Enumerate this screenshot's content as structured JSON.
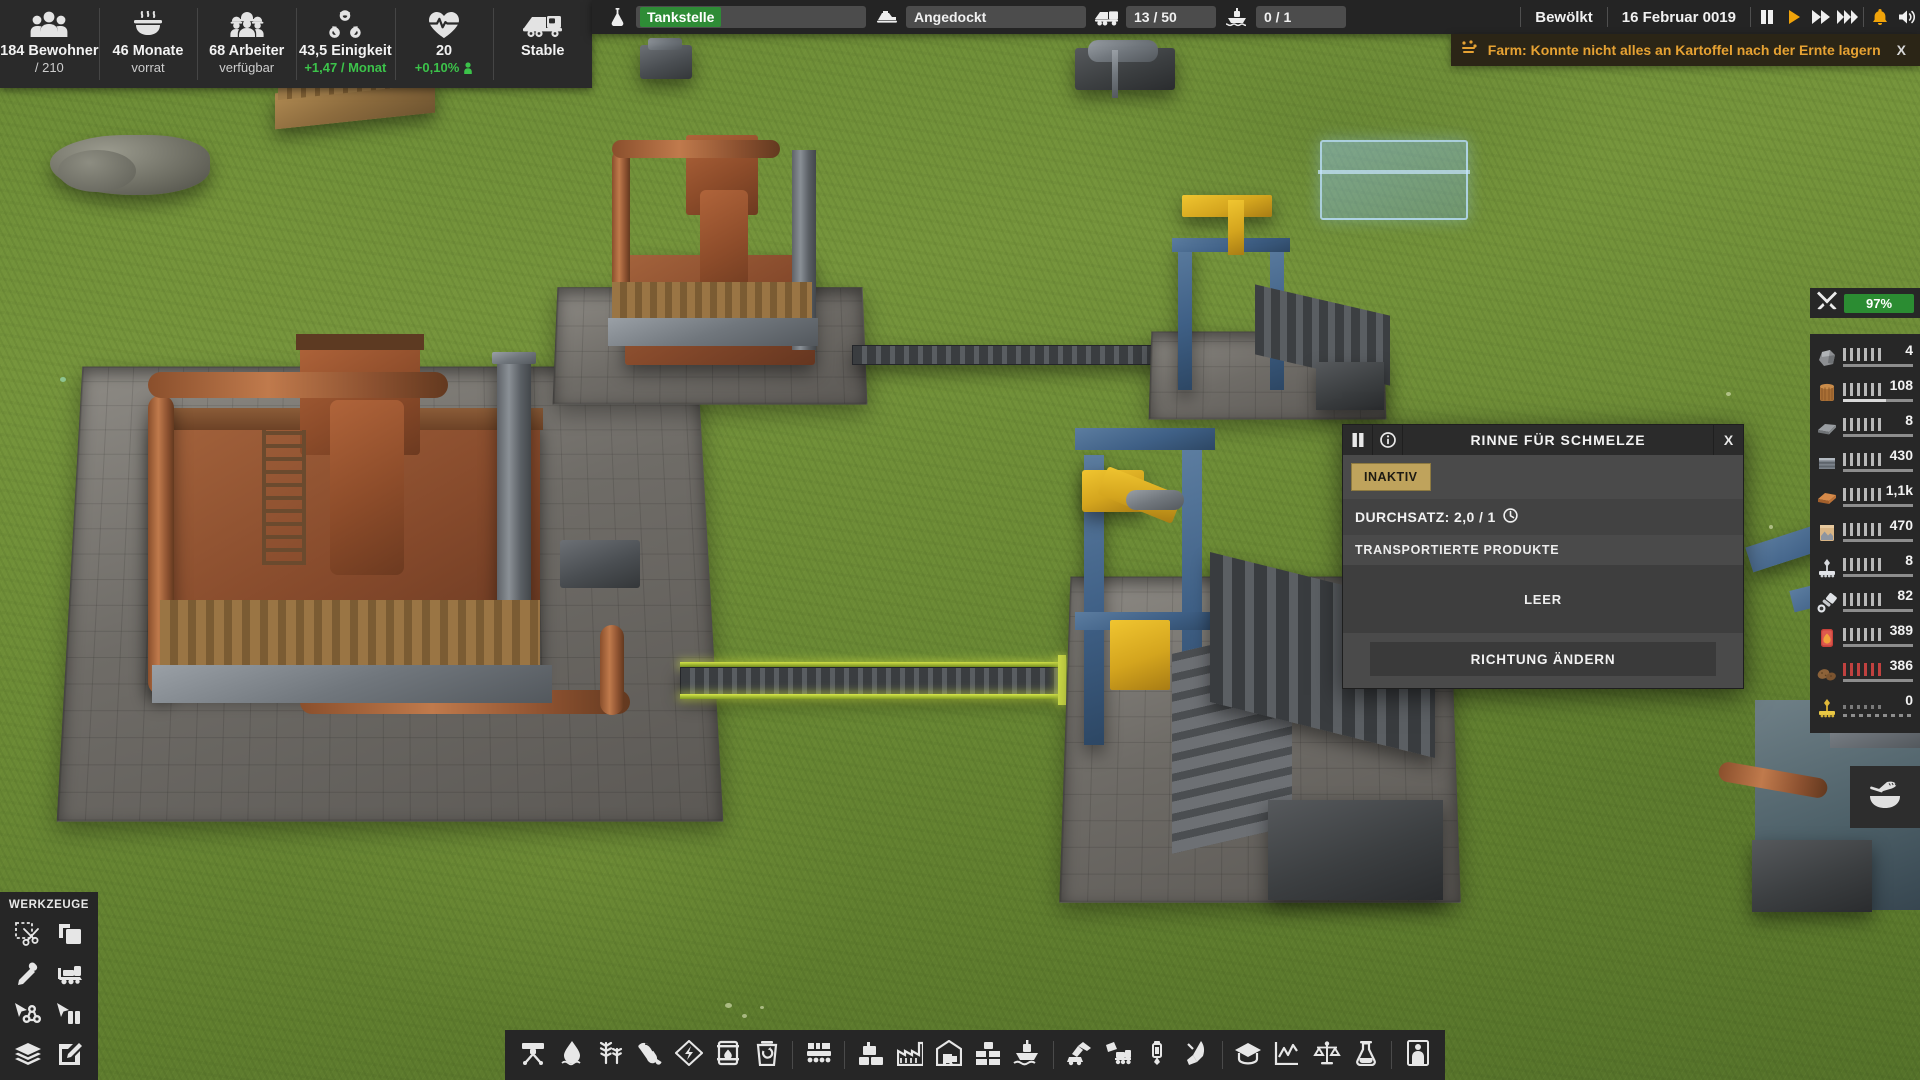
{
  "hud_left": {
    "stats": [
      {
        "icon": "population-icon",
        "main": "184 Bewohner",
        "sub": "/ 210",
        "sub_style": "normal"
      },
      {
        "icon": "food-bowl-icon",
        "main": "46 Monate",
        "sub": "vorrat",
        "sub_style": "normal"
      },
      {
        "icon": "workers-icon",
        "main": "68 Arbeiter",
        "sub": "verfügbar",
        "sub_style": "normal"
      },
      {
        "icon": "unity-icon",
        "main": "43,5 Einigkeit",
        "sub": "+1,47 / Monat",
        "sub_style": "green"
      },
      {
        "icon": "health-icon",
        "main": "20",
        "sub": "+0,10%",
        "sub_style": "green_person"
      },
      {
        "icon": "truck-icon",
        "main": "Stable",
        "sub": "",
        "sub_style": "normal"
      }
    ]
  },
  "top_bar": {
    "flask_icon": "flask-icon",
    "status_chip": "Tankstelle",
    "dock_icon": "dock-icon",
    "dock_value": "Angedockt",
    "truck_icon": "truck-icon",
    "truck_value": "13 / 50",
    "ship_icon": "ship-icon",
    "ship_value": "0 / 1",
    "weather": "Bewölkt",
    "date": "16 Februar 0019",
    "controls": [
      {
        "name": "pause-button",
        "icon": "pause-icon"
      },
      {
        "name": "play-button",
        "icon": "play-icon"
      },
      {
        "name": "fast-forward-button",
        "icon": "fast-forward-icon"
      },
      {
        "name": "very-fast-forward-button",
        "icon": "very-fast-forward-icon"
      }
    ],
    "bell_icon": "bell-icon",
    "sound_icon": "speaker-icon"
  },
  "notification": {
    "icon": "harvest-icon",
    "text": "Farm: Konnte nicht alles an Kartoffel nach der Ernte lagern",
    "close_label": "X",
    "accent_color": "#e6a233",
    "background_color": "#2b2516"
  },
  "resources": {
    "header": {
      "icon": "tools-icon",
      "percent": "97%",
      "percent_color": "#2b8c32"
    },
    "items": [
      {
        "icon": "ore-rock-icon",
        "value": "4",
        "bar_color": "#b9b9b9",
        "fill": 0,
        "dotted": false
      },
      {
        "icon": "wood-log-icon",
        "value": "108",
        "bar_color": "#b9b9b9",
        "fill": 62,
        "dotted": false
      },
      {
        "icon": "stone-slab-icon",
        "value": "8",
        "bar_color": "#b9b9b9",
        "fill": 0,
        "dotted": false
      },
      {
        "icon": "steel-beam-icon",
        "value": "430",
        "bar_color": "#b9b9b9",
        "fill": 0,
        "dotted": false
      },
      {
        "icon": "plank-icon",
        "value": "1,1k",
        "bar_color": "#b9b9b9",
        "fill": 0,
        "dotted": false
      },
      {
        "icon": "cement-bag-icon",
        "value": "470",
        "bar_color": "#b9b9b9",
        "fill": 0,
        "dotted": false
      },
      {
        "icon": "machine-part-icon",
        "value": "8",
        "bar_color": "#b9b9b9",
        "fill": 0,
        "dotted": false
      },
      {
        "icon": "piston-icon",
        "value": "82",
        "bar_color": "#b9b9b9",
        "fill": 0,
        "dotted": false
      },
      {
        "icon": "fuel-can-icon",
        "value": "389",
        "bar_color": "#b9b9b9",
        "fill": 0,
        "dotted": false
      },
      {
        "icon": "potato-icon",
        "value": "386",
        "bar_color": "#c0413f",
        "fill": 0,
        "dotted": false
      },
      {
        "icon": "gold-part-icon",
        "value": "0",
        "bar_color": "#7a7a7a",
        "fill": 0,
        "dotted": true
      }
    ]
  },
  "side_button": {
    "icon": "food-bowl-icon"
  },
  "tools_panel": {
    "title": "WERKZEUGE",
    "items": [
      {
        "name": "tool-cut",
        "icon": "scissors-select-icon"
      },
      {
        "name": "tool-copy",
        "icon": "copy-icon"
      },
      {
        "name": "tool-eyedropper",
        "icon": "eyedropper-icon"
      },
      {
        "name": "tool-bulldozer",
        "icon": "bulldozer-icon"
      },
      {
        "name": "tool-cursor-unity",
        "icon": "cursor-unity-icon"
      },
      {
        "name": "tool-cursor-pause",
        "icon": "cursor-pause-icon"
      },
      {
        "name": "tool-layers",
        "icon": "layers-icon"
      },
      {
        "name": "tool-edit",
        "icon": "edit-pencil-icon"
      }
    ]
  },
  "bottom_bar": {
    "groups": [
      {
        "items": [
          {
            "name": "build-crane",
            "icon": "crane-icon"
          },
          {
            "name": "build-water",
            "icon": "water-drop-icon"
          },
          {
            "name": "build-farm",
            "icon": "crops-icon"
          },
          {
            "name": "build-hand",
            "icon": "hand-gather-icon"
          },
          {
            "name": "build-power",
            "icon": "power-bolt-icon"
          },
          {
            "name": "build-oil-barrel",
            "icon": "oil-barrel-icon"
          },
          {
            "name": "build-recycling",
            "icon": "recycling-bin-icon"
          }
        ]
      },
      {
        "items": [
          {
            "name": "build-conveyor",
            "icon": "conveyor-icon"
          }
        ]
      },
      {
        "items": [
          {
            "name": "build-residential",
            "icon": "residential-icon"
          },
          {
            "name": "build-factory",
            "icon": "factory-icon"
          },
          {
            "name": "build-warehouse",
            "icon": "warehouse-icon"
          },
          {
            "name": "build-depot",
            "icon": "depot-icon"
          },
          {
            "name": "build-harbor",
            "icon": "harbor-icon"
          }
        ]
      },
      {
        "items": [
          {
            "name": "build-excavator",
            "icon": "excavator-icon"
          },
          {
            "name": "build-mining-truck",
            "icon": "mining-truck-icon"
          },
          {
            "name": "build-drill",
            "icon": "drill-icon"
          },
          {
            "name": "build-rocket",
            "icon": "rocket-icon"
          }
        ]
      },
      {
        "items": [
          {
            "name": "menu-education",
            "icon": "graduation-cap-icon"
          },
          {
            "name": "menu-statistics",
            "icon": "chart-line-icon"
          },
          {
            "name": "menu-trade",
            "icon": "scales-icon"
          },
          {
            "name": "menu-research",
            "icon": "flask-icon"
          }
        ]
      },
      {
        "items": [
          {
            "name": "menu-population",
            "icon": "person-stats-icon"
          }
        ]
      }
    ]
  },
  "dialog": {
    "title": "RINNE FÜR SCHMELZE",
    "pause_icon": "pause-icon",
    "info_icon": "info-icon",
    "close_label": "X",
    "status_badge": "INAKTIV",
    "status_badge_color": "#bfa35c",
    "rate_label": "DURCHSATZ: 2,0 / 1",
    "rate_icon": "clock-icon",
    "section_label": "TRANSPORTIERTE PRODUKTE",
    "empty_label": "LEER",
    "action_label": "RICHTUNG ÄNDERN"
  }
}
